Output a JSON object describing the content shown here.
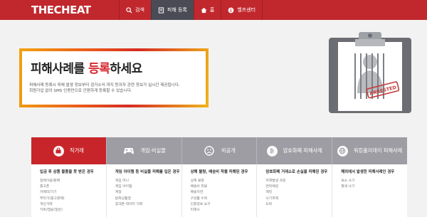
{
  "header": {
    "logo": "THECHEAT",
    "nav": [
      {
        "label": "검색",
        "icon": "search-icon",
        "active": false
      },
      {
        "label": "피해 등록",
        "icon": "register-icon",
        "active": true
      },
      {
        "label": "홈",
        "icon": "home-icon",
        "active": false
      },
      {
        "label": "헬프센터",
        "icon": "info-icon",
        "active": false
      }
    ]
  },
  "hero": {
    "title_pre": "피해사례를 ",
    "title_highlight": "등록",
    "title_post": "하세요",
    "desc_line1": "피해사례 등록시 피해 발생 정보부터 검거소식 까지 등의자 관련 정보가 실시간 제공됩니다.",
    "desc_line2": "회원가입 없이 SMS 인증만으로 간편하게 등록할 수 있습니다.",
    "stamp": "ARRESTED"
  },
  "tabs": [
    {
      "label": "직거래",
      "icon": "trade-icon",
      "active": true
    },
    {
      "label": "게임·비실물",
      "icon": "gamepad-icon",
      "active": false
    },
    {
      "label": "비공개",
      "icon": "sad-face-icon",
      "active": false
    },
    {
      "label": "암호화폐 피해사례",
      "icon": "crypto-icon",
      "active": false
    },
    {
      "label": "워킹홀리데이 피해사례",
      "icon": "globe-icon",
      "active": false
    }
  ],
  "categories": [
    {
      "title": "입금 후 상품 물품을 못 받은 경우",
      "items": [
        "업체이용/판매",
        "중고폰",
        "카메라/기기",
        "부터기(중고판매)",
        "개인거래",
        "키트/캡숑(일반)"
      ]
    },
    {
      "title": "게임 아이템 등 비실물 피해를 입은 경우",
      "items": [
        "게임 머니",
        "게임 아이템",
        "계정",
        "문화상품권",
        "휴대폰 데이터 거래"
      ]
    },
    {
      "title": "상해 불량, 배송비 착불 피해된 경우",
      "items": [
        "상해 불량",
        "배송비 착불",
        "배송지연",
        "구성품 누락",
        "인증정보 요구",
        "피해사"
      ]
    },
    {
      "title": "암호화폐 거래소로 손실을 피해된 경우",
      "items": [
        "피해발생 과정",
        "연락채널",
        "해킹",
        "사기피해",
        "도박"
      ]
    },
    {
      "title": "해외에서 발생한 피해사례인 경우",
      "items": [
        "숙소 사기",
        "월세 사기"
      ]
    }
  ]
}
